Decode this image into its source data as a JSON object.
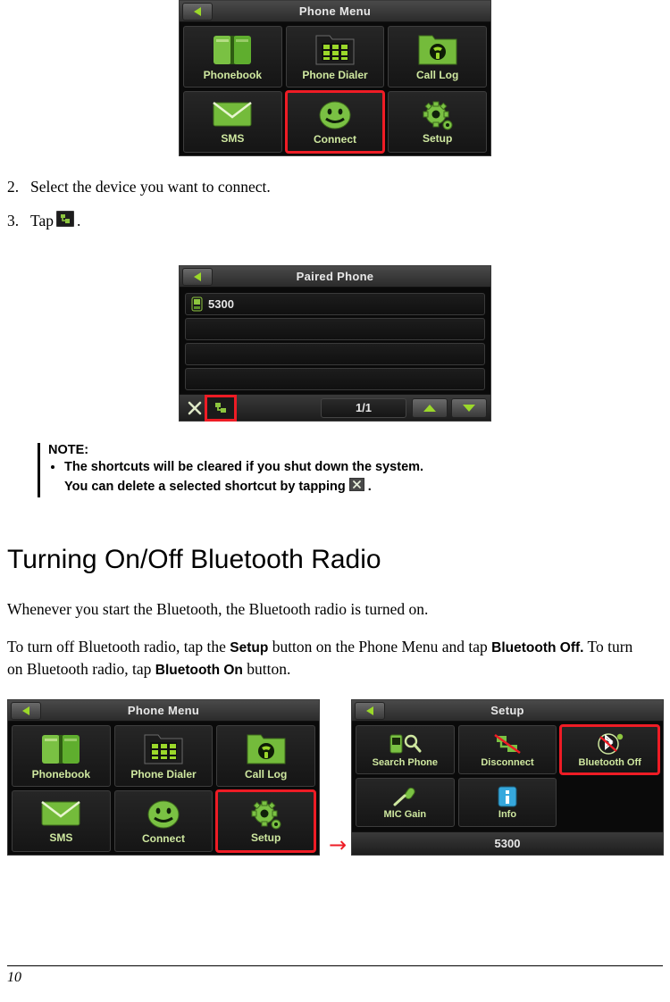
{
  "page_number": "10",
  "steps": [
    {
      "num": "2.",
      "text": "Select the device you want to connect."
    },
    {
      "num": "3.",
      "text": "Tap",
      "text_after": "."
    }
  ],
  "screens": {
    "phone_menu_top": {
      "title": "Phone Menu",
      "tiles": [
        {
          "label": "Phonebook",
          "icon": "book-icon",
          "highlight": false
        },
        {
          "label": "Phone Dialer",
          "icon": "keypad-icon",
          "highlight": false
        },
        {
          "label": "Call Log",
          "icon": "call-log-icon",
          "highlight": false
        },
        {
          "label": "SMS",
          "icon": "envelope-icon",
          "highlight": false
        },
        {
          "label": "Connect",
          "icon": "smiley-icon",
          "highlight": true
        },
        {
          "label": "Setup",
          "icon": "gear-icon",
          "highlight": false
        }
      ]
    },
    "paired_phone": {
      "title": "Paired Phone",
      "rows": [
        {
          "label": "5300",
          "icon": "phone-device-icon"
        },
        {
          "label": "",
          "icon": ""
        },
        {
          "label": "",
          "icon": ""
        },
        {
          "label": "",
          "icon": ""
        }
      ],
      "page_indicator": "1/1",
      "delete_icon": "x-icon",
      "connect_icon": "connect-icon",
      "up_icon": "triangle-up-icon",
      "down_icon": "triangle-down-icon"
    },
    "phone_menu_bottom": {
      "title": "Phone Menu",
      "tiles": [
        {
          "label": "Phonebook",
          "icon": "book-icon",
          "highlight": false
        },
        {
          "label": "Phone Dialer",
          "icon": "keypad-icon",
          "highlight": false
        },
        {
          "label": "Call Log",
          "icon": "call-log-icon",
          "highlight": false
        },
        {
          "label": "SMS",
          "icon": "envelope-icon",
          "highlight": false
        },
        {
          "label": "Connect",
          "icon": "smiley-icon",
          "highlight": false
        },
        {
          "label": "Setup",
          "icon": "gear-icon",
          "highlight": true
        }
      ]
    },
    "setup": {
      "title": "Setup",
      "tiles": [
        {
          "label": "Search Phone",
          "icon": "search-phone-icon",
          "highlight": false
        },
        {
          "label": "Disconnect",
          "icon": "disconnect-icon",
          "highlight": false
        },
        {
          "label": "Bluetooth Off",
          "icon": "bluetooth-off-icon",
          "highlight": true
        },
        {
          "label": "MIC Gain",
          "icon": "microphone-icon",
          "highlight": false
        },
        {
          "label": "Info",
          "icon": "info-icon",
          "highlight": false
        }
      ],
      "status": "5300"
    }
  },
  "note": {
    "title": "NOTE:",
    "items": [
      {
        "text": "The shortcuts will be cleared if you shut down the system."
      },
      {
        "text_before": "You can delete a selected shortcut by tapping",
        "icon": "x-icon",
        "text_after": "."
      }
    ]
  },
  "heading": "Turning On/Off Bluetooth Radio",
  "paragraphs": [
    {
      "text": "Whenever you start the Bluetooth, the Bluetooth radio is turned on."
    }
  ],
  "paragraph2": {
    "p1": "To turn off Bluetooth radio, tap the ",
    "b1": "Setup",
    "p2": " button on the Phone Menu and tap ",
    "b2": "Bluetooth Off.",
    "p3": " To turn on Bluetooth radio, tap ",
    "b3": "Bluetooth On",
    "p4": " button."
  },
  "flow_arrow": "→",
  "colors": {
    "highlight": "#ee1c25",
    "accent_green": "#8dc63f",
    "tile_label": "#cfe8a0"
  }
}
